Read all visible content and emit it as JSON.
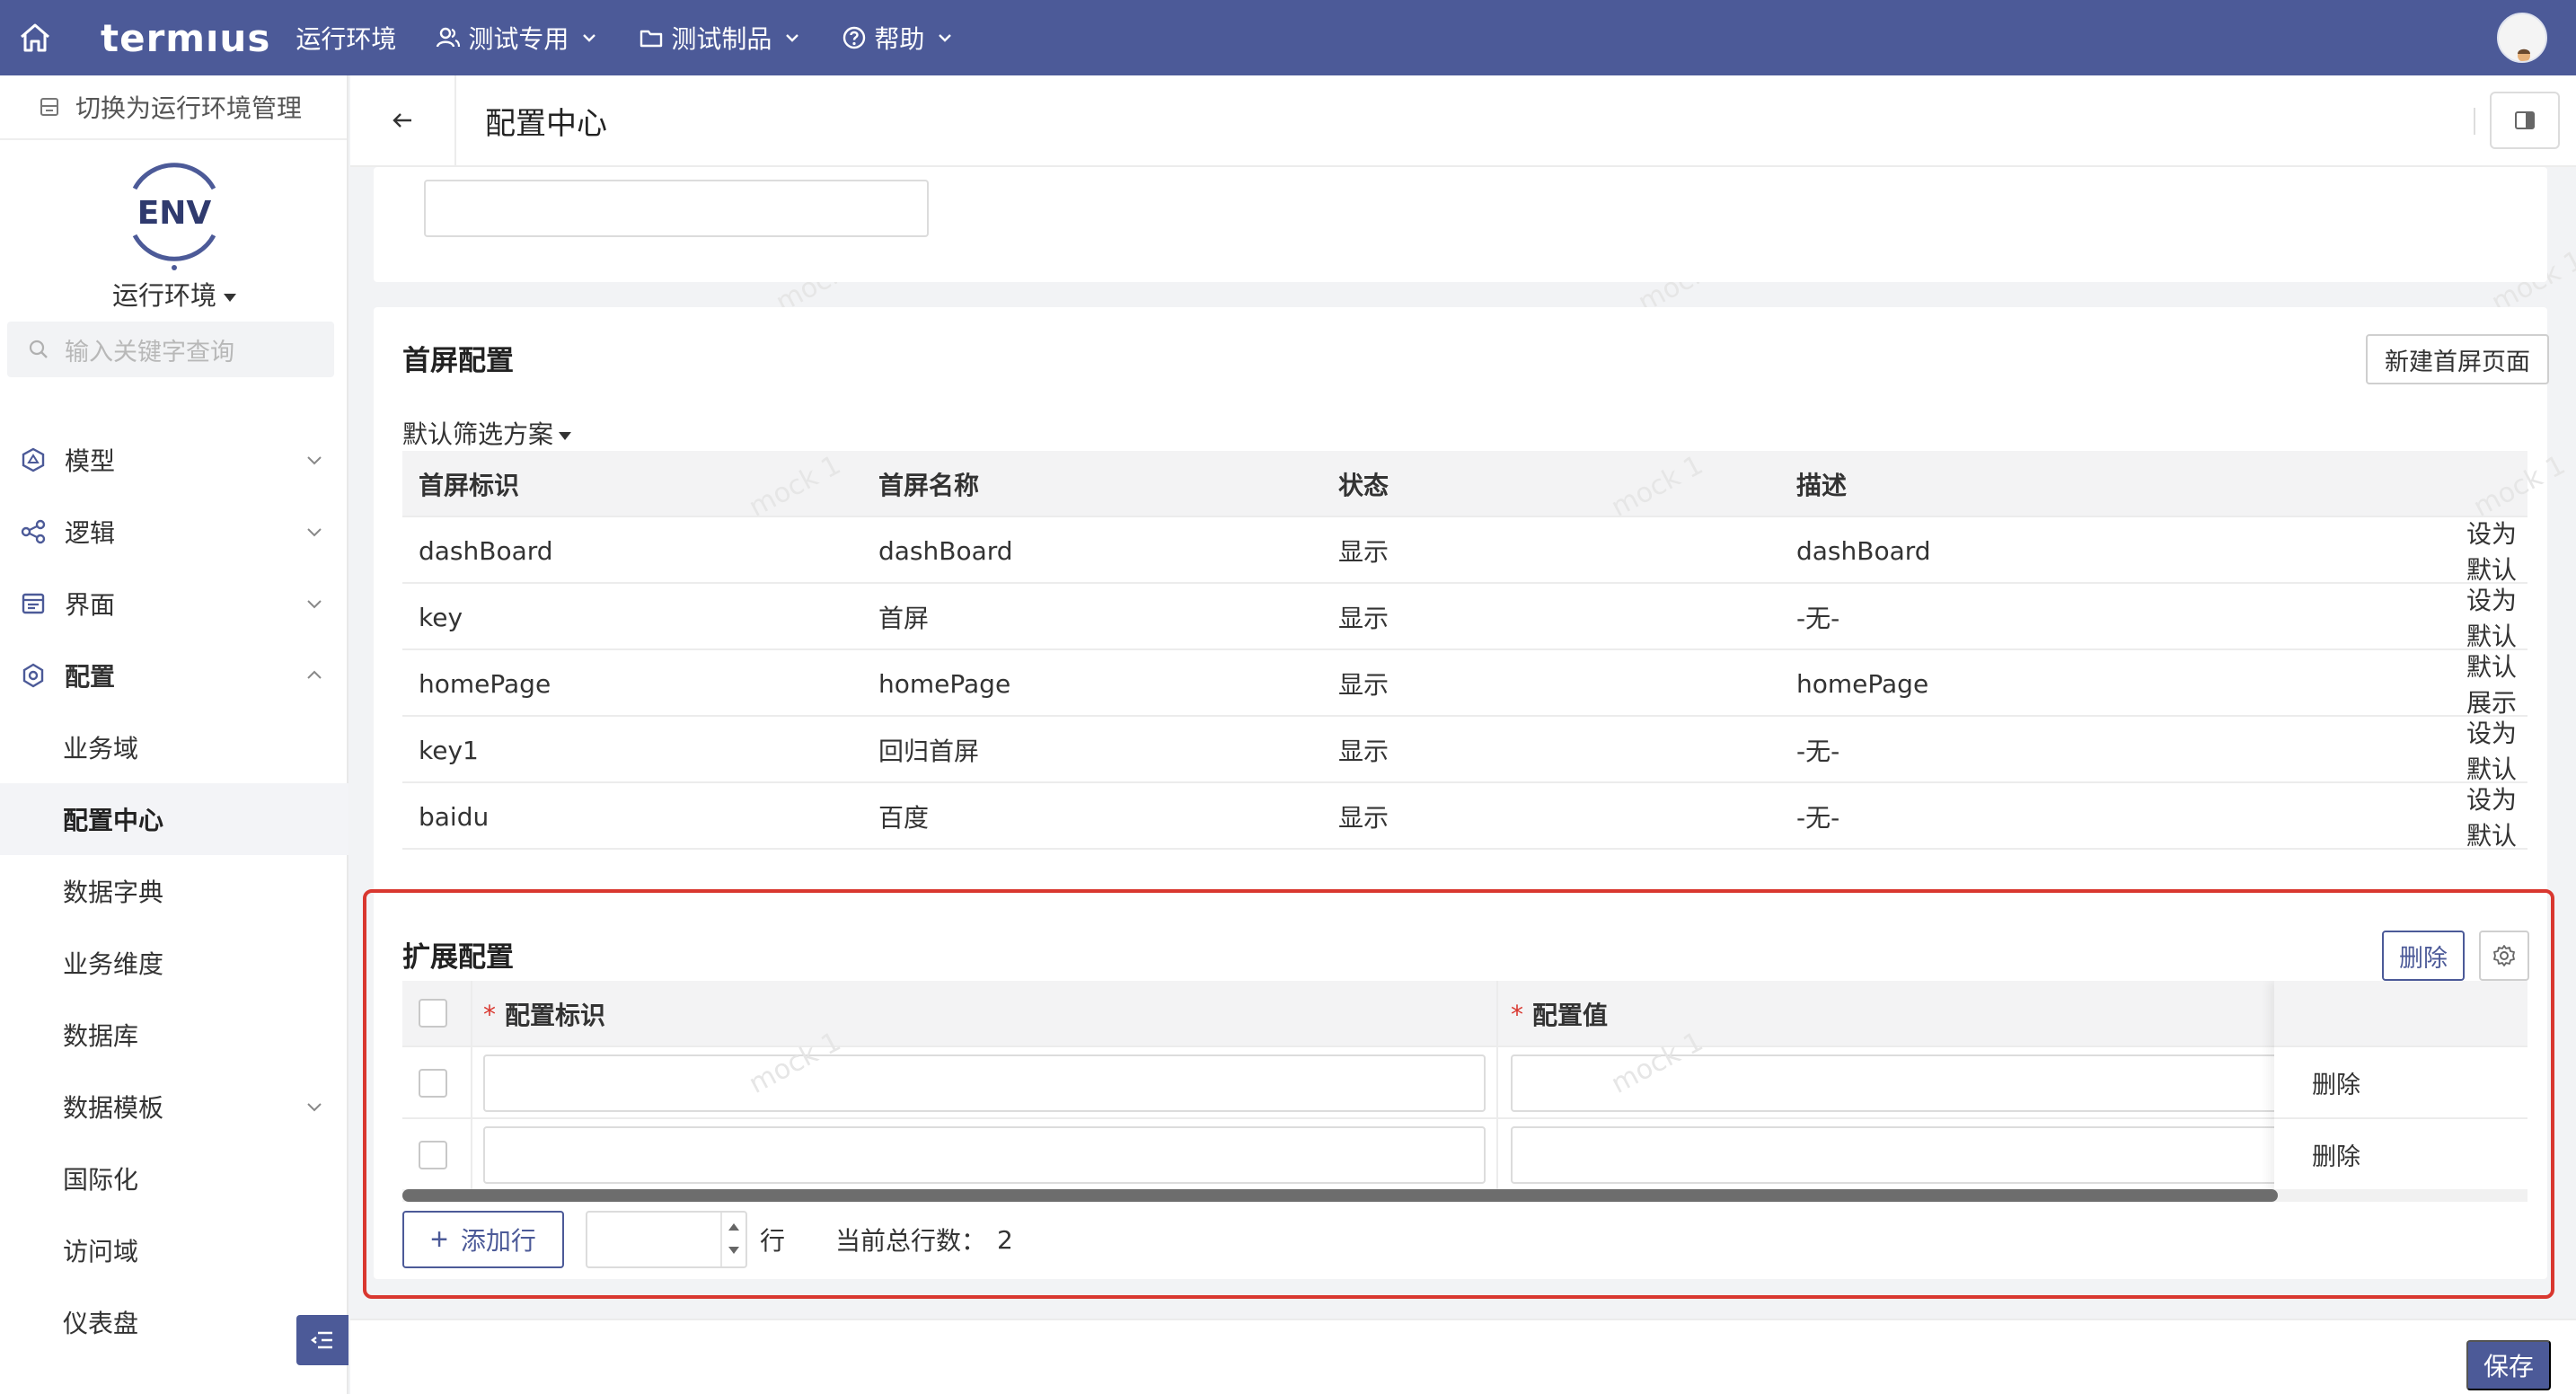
{
  "topbar": {
    "logo": "termıus",
    "env": "运行环境",
    "menus": [
      {
        "label": "测试专用",
        "icon": "users-icon"
      },
      {
        "label": "测试制品",
        "icon": "folder-icon"
      },
      {
        "label": "帮助",
        "icon": "help-circle-icon"
      }
    ],
    "bg_color": "#4c5a98"
  },
  "sidebar": {
    "switch_label": "切换为运行环境管理",
    "logo_text": "ENV",
    "env_name": "运行环境",
    "search_placeholder": "输入关键字查询",
    "items": [
      {
        "label": "模型",
        "icon": "model-icon",
        "expanded": false
      },
      {
        "label": "逻辑",
        "icon": "logic-icon",
        "expanded": false
      },
      {
        "label": "界面",
        "icon": "ui-icon",
        "expanded": false
      },
      {
        "label": "配置",
        "icon": "config-icon",
        "expanded": true
      }
    ],
    "sub_items": [
      "业务域",
      "配置中心",
      "数据字典",
      "业务维度",
      "数据库",
      "数据模板",
      "国际化",
      "访问域",
      "仪表盘"
    ],
    "active_sub": "配置中心"
  },
  "header": {
    "title": "配置中心"
  },
  "home_config": {
    "title": "首屏配置",
    "new_button": "新建首屏页面",
    "filter_label": "默认筛选方案",
    "columns": [
      "首屏标识",
      "首屏名称",
      "状态",
      "描述"
    ],
    "rows": [
      {
        "id": "dashBoard",
        "name": "dashBoard",
        "status": "显示",
        "desc": "dashBoard",
        "action": "设为默认",
        "action_enabled": true
      },
      {
        "id": "key",
        "name": "首屏",
        "status": "显示",
        "desc": "-无-",
        "action": "设为默认",
        "action_enabled": true
      },
      {
        "id": "homePage",
        "name": "homePage",
        "status": "显示",
        "desc": "homePage",
        "action": "默认展示",
        "action_enabled": false
      },
      {
        "id": "key1",
        "name": "回归首屏",
        "status": "显示",
        "desc": "-无-",
        "action": "设为默认",
        "action_enabled": true
      },
      {
        "id": "baidu",
        "name": "百度",
        "status": "显示",
        "desc": "-无-",
        "action": "设为默认",
        "action_enabled": true
      }
    ],
    "more_glyph": "···"
  },
  "ext_config": {
    "title": "扩展配置",
    "delete_button": "删除",
    "columns": [
      "配置标识",
      "配置值"
    ],
    "required_mark": "*",
    "rows": [
      {
        "key": "",
        "value": "",
        "action": "删除"
      },
      {
        "key": "",
        "value": "",
        "action": "删除"
      }
    ],
    "add_row_label": "添加行",
    "add_row_count": "",
    "row_unit": "行",
    "total_label": "当前总行数：",
    "total_value": "2"
  },
  "footer": {
    "save_label": "保存"
  },
  "watermark": "mock 1",
  "colors": {
    "primary": "#4c5a98",
    "link": "#3b5aa6",
    "highlight": "#d9372f"
  }
}
